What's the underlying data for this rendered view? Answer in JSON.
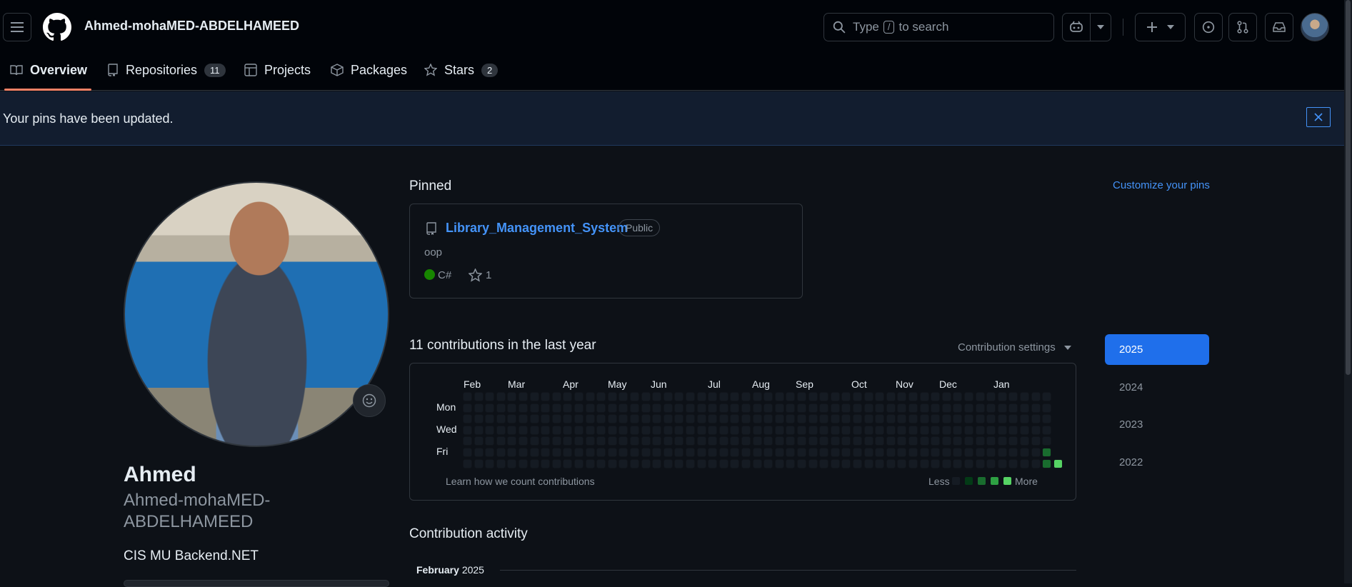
{
  "header": {
    "username": "Ahmed-mohaMED-ABDELHAMEED",
    "search_before": "Type",
    "search_key": "/",
    "search_after": "to search"
  },
  "tabs": [
    {
      "label": "Overview",
      "count": ""
    },
    {
      "label": "Repositories",
      "count": "11"
    },
    {
      "label": "Projects",
      "count": ""
    },
    {
      "label": "Packages",
      "count": ""
    },
    {
      "label": "Stars",
      "count": "2"
    }
  ],
  "flash": {
    "message": "Your pins have been updated."
  },
  "profile": {
    "name": "Ahmed",
    "login_line1": "Ahmed-mohaMED-",
    "login_line2": "ABDELHAMEED",
    "bio": "CIS MU Backend.NET"
  },
  "pinned": {
    "title": "Pinned",
    "customize": "Customize your pins",
    "repo": {
      "name": "Library_Management_System",
      "visibility": "Public",
      "description": "oop",
      "language": "C#",
      "language_color": "#178600",
      "stars": "1"
    }
  },
  "contributions": {
    "title": "11 contributions in the last year",
    "settings": "Contribution settings",
    "months": [
      "Feb",
      "Mar",
      "Apr",
      "May",
      "Jun",
      "Jul",
      "Aug",
      "Sep",
      "Oct",
      "Nov",
      "Dec",
      "Jan"
    ],
    "days": [
      "Mon",
      "Wed",
      "Fri"
    ],
    "learn": "Learn how we count contributions",
    "less": "Less",
    "more": "More",
    "colors": [
      "#151b23",
      "#033a16",
      "#196c2e",
      "#2ea043",
      "#56d364"
    ]
  },
  "years": [
    "2025",
    "2024",
    "2023",
    "2022"
  ],
  "activity": {
    "title": "Contribution activity",
    "month": "February",
    "year": "2025"
  }
}
